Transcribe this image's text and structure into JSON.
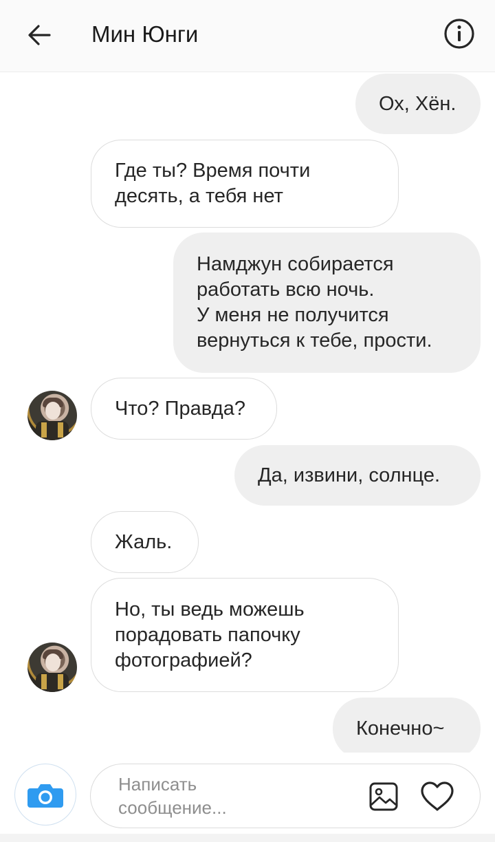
{
  "header": {
    "title": "Мин Юнги",
    "back_icon": "arrow-left-icon",
    "info_icon": "info-circle-icon"
  },
  "messages": [
    {
      "direction": "out",
      "text": "Ох, Хён."
    },
    {
      "direction": "in",
      "text": "Где ты? Время почти\nдесять, а тебя нет"
    },
    {
      "direction": "out",
      "text": "Намджун собирается\nработать всю ночь.\nУ меня не получится\nвернуться к тебе, прости."
    },
    {
      "direction": "in",
      "text": "Что? Правда?"
    },
    {
      "direction": "out",
      "text": "Да, извини, солнце."
    },
    {
      "direction": "in",
      "text": "Жаль."
    },
    {
      "direction": "in",
      "text": "Но, ты ведь можешь\nпорадовать папочку\nфотографией?"
    },
    {
      "direction": "out",
      "text": "Конечно~"
    }
  ],
  "composer": {
    "placeholder": "Написать\nсообщение...",
    "camera_icon": "camera-icon",
    "gallery_icon": "gallery-icon",
    "heart_icon": "heart-icon"
  },
  "colors": {
    "outgoing_bubble": "#efefef",
    "incoming_border": "#dcdcdc",
    "camera_accent": "#2f9bf0"
  }
}
